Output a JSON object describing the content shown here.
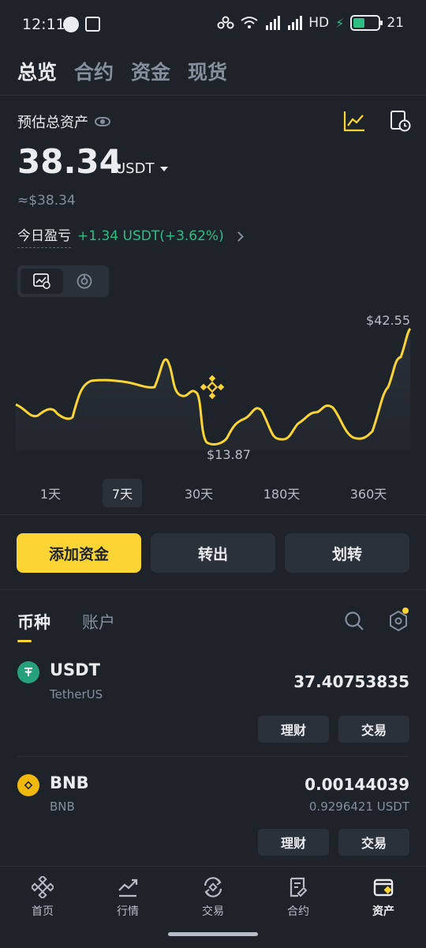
{
  "status_bar": {
    "time": "12:11",
    "right_text": "HD",
    "battery": "21"
  },
  "top_tabs": [
    {
      "label": "总览",
      "active": true
    },
    {
      "label": "合约",
      "active": false
    },
    {
      "label": "资金",
      "active": false
    },
    {
      "label": "现货",
      "active": false
    }
  ],
  "overview": {
    "estimated_label": "预估总资产",
    "amount": "38.34",
    "unit": "USDT",
    "approx": "≈$38.34",
    "pnl_label": "今日盈亏",
    "pnl_value": "+1.34 USDT(+3.62%)"
  },
  "chart": {
    "peak_label": "$42.55",
    "low_label": "$13.87",
    "periods": [
      "1天",
      "7天",
      "30天",
      "180天",
      "360天"
    ],
    "active_period": "7天",
    "line_color": "#fcd535"
  },
  "actions": {
    "add_funds": "添加资金",
    "withdraw": "转出",
    "transfer": "划转"
  },
  "section_tabs": [
    {
      "label": "币种",
      "active": true
    },
    {
      "label": "账户",
      "active": false
    }
  ],
  "coins": [
    {
      "symbol": "USDT",
      "name": "TetherUS",
      "amount": "37.40753835",
      "fiat": "",
      "color": "#26a17b",
      "btn_earn": "理财",
      "btn_trade": "交易"
    },
    {
      "symbol": "BNB",
      "name": "BNB",
      "amount": "0.00144039",
      "fiat": "0.9296421 USDT",
      "color": "#f0b90b",
      "btn_earn": "理财",
      "btn_trade": "交易"
    }
  ],
  "bottom_nav": [
    {
      "label": "首页",
      "icon": "binance-home-icon",
      "active": false
    },
    {
      "label": "行情",
      "icon": "markets-icon",
      "active": false
    },
    {
      "label": "交易",
      "icon": "trade-icon",
      "active": false
    },
    {
      "label": "合约",
      "icon": "futures-icon",
      "active": false
    },
    {
      "label": "资产",
      "icon": "wallet-icon",
      "active": true
    }
  ],
  "colors": {
    "accent": "#fcd535",
    "positive": "#2ebd85",
    "background": "#1e2329"
  }
}
